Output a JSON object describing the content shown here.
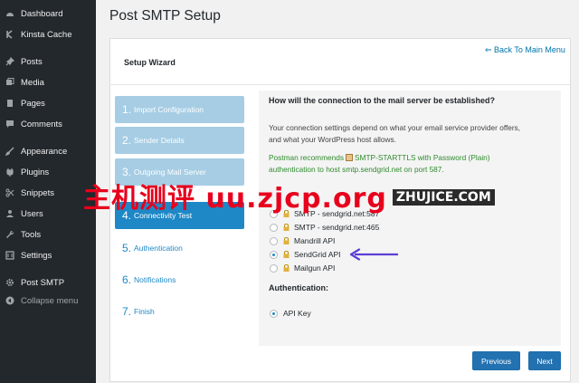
{
  "sidebar": {
    "items": [
      {
        "label": "Dashboard",
        "icon": "dashboard-icon"
      },
      {
        "label": "Kinsta Cache",
        "icon": "kinsta-icon"
      },
      {
        "label": "Posts",
        "icon": "pin-icon"
      },
      {
        "label": "Media",
        "icon": "media-icon"
      },
      {
        "label": "Pages",
        "icon": "pages-icon"
      },
      {
        "label": "Comments",
        "icon": "comments-icon"
      },
      {
        "label": "Appearance",
        "icon": "brush-icon"
      },
      {
        "label": "Plugins",
        "icon": "plugin-icon"
      },
      {
        "label": "Snippets",
        "icon": "scissors-icon"
      },
      {
        "label": "Users",
        "icon": "users-icon"
      },
      {
        "label": "Tools",
        "icon": "wrench-icon"
      },
      {
        "label": "Settings",
        "icon": "settings-icon"
      },
      {
        "label": "Post SMTP",
        "icon": "gear-icon"
      },
      {
        "label": "Collapse menu",
        "icon": "collapse-icon"
      }
    ]
  },
  "page": {
    "title": "Post SMTP Setup",
    "wizard_label": "Setup Wizard",
    "back_link": "⇐ Back To Main Menu"
  },
  "steps": [
    {
      "num": "1.",
      "label": "Import Configuration",
      "state": "done"
    },
    {
      "num": "2.",
      "label": "Sender Details",
      "state": "done"
    },
    {
      "num": "3.",
      "label": "Outgoing Mail Server",
      "state": "done"
    },
    {
      "num": "4.",
      "label": "Connectivity Test",
      "state": "active"
    },
    {
      "num": "5.",
      "label": "Authentication",
      "state": "todo"
    },
    {
      "num": "6.",
      "label": "Notifications",
      "state": "todo"
    },
    {
      "num": "7.",
      "label": "Finish",
      "state": "todo"
    }
  ],
  "content": {
    "question": "How will the connection to the mail server be established?",
    "para1_line1": "Your connection settings depend on what your email service provider offers,",
    "para1_line2": "and what your WordPress host allows.",
    "rec_part1": "Postman recommends",
    "rec_part2": "SMTP-STARTTLS with Password (Plain)",
    "rec_line2": "authentication to host smtp.sendgrid.net on port 587.",
    "options": [
      {
        "label": "SMTP - sendgrid.net:587",
        "selected": false
      },
      {
        "label": "SMTP - sendgrid.net:465",
        "selected": false
      },
      {
        "label": "Mandrill API",
        "selected": false
      },
      {
        "label": "SendGrid API",
        "selected": true
      },
      {
        "label": "Mailgun API",
        "selected": false
      }
    ],
    "auth_label": "Authentication:",
    "auth_option": "API Key"
  },
  "buttons": {
    "previous": "Previous",
    "next": "Next"
  },
  "watermark": {
    "text": "主机测评 uu.zjcp.org",
    "small": "ZHUJICE.COM"
  },
  "colors": {
    "sidebar_bg": "#23282d",
    "accent": "#1e88c7",
    "step_done": "#a6cde4",
    "button": "#2271b1",
    "recommend_text": "#2e8b2e",
    "arrow": "#5b3fd6",
    "watermark": "#e8001c"
  }
}
